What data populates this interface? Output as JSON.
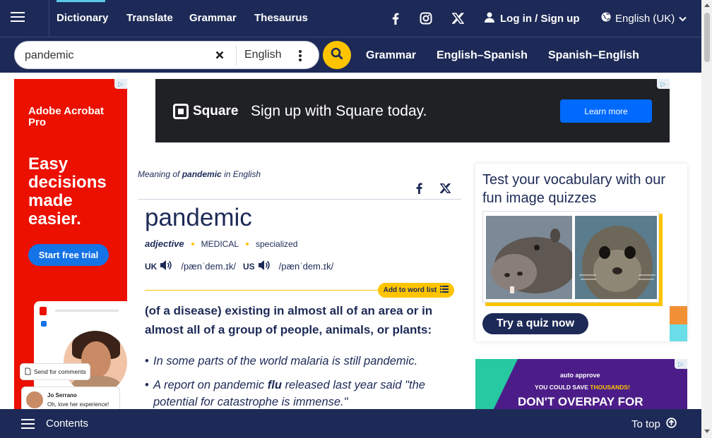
{
  "nav": {
    "menu_icon": "hamburger-icon",
    "links": [
      "Dictionary",
      "Translate",
      "Grammar",
      "Thesaurus"
    ],
    "active": "Dictionary",
    "social_icons": [
      "facebook-icon",
      "instagram-icon",
      "x-icon"
    ],
    "login_label": "Log in / Sign up",
    "language_label": "English (UK)"
  },
  "search": {
    "value": "pandemic",
    "dictionary": "English",
    "sublinks": [
      "Grammar",
      "English–Spanish",
      "Spanish–English"
    ]
  },
  "ads": {
    "left": {
      "brand": "Adobe Acrobat Pro",
      "headline": "Easy decisions made easier.",
      "button": "Start free trial",
      "chip": "Send for comments",
      "commenter": "Jo Serrano",
      "comment": "Oh, love her experience!"
    },
    "top": {
      "brand": "Square",
      "text": "Sign up with Square today.",
      "button": "Learn more"
    },
    "bottom": {
      "brand": "auto approve",
      "save_prefix": "YOU COULD SAVE ",
      "save_highlight": "THOUSANDS!",
      "headline": "DON'T OVERPAY FOR"
    }
  },
  "entry": {
    "meaning_prefix": "Meaning of ",
    "meaning_word": "pandemic",
    "meaning_suffix": " in English",
    "headword": "pandemic",
    "pos": "adjective",
    "labels": [
      "MEDICAL",
      "specialized"
    ],
    "pronunciations": [
      {
        "region": "UK",
        "ipa": "/pænˈdem.ɪk/"
      },
      {
        "region": "US",
        "ipa": "/pænˈdem.ɪk/"
      }
    ],
    "add_to_list": "Add to word list",
    "definition": "(of a disease) existing in almost all of an area or in almost all of a group of people, animals, or plants:",
    "examples": [
      {
        "before": "In some parts of the world malaria is still pandemic.",
        "bold": "",
        "after": ""
      },
      {
        "before": "A report on pandemic ",
        "bold": "flu",
        "after": " released last year said \"the potential for catastrophe is immense.\""
      }
    ]
  },
  "quiz": {
    "title": "Test your vocabulary with our fun image quizzes",
    "button": "Try a quiz now"
  },
  "footer": {
    "contents_label": "Contents",
    "to_top_label": "To top"
  }
}
